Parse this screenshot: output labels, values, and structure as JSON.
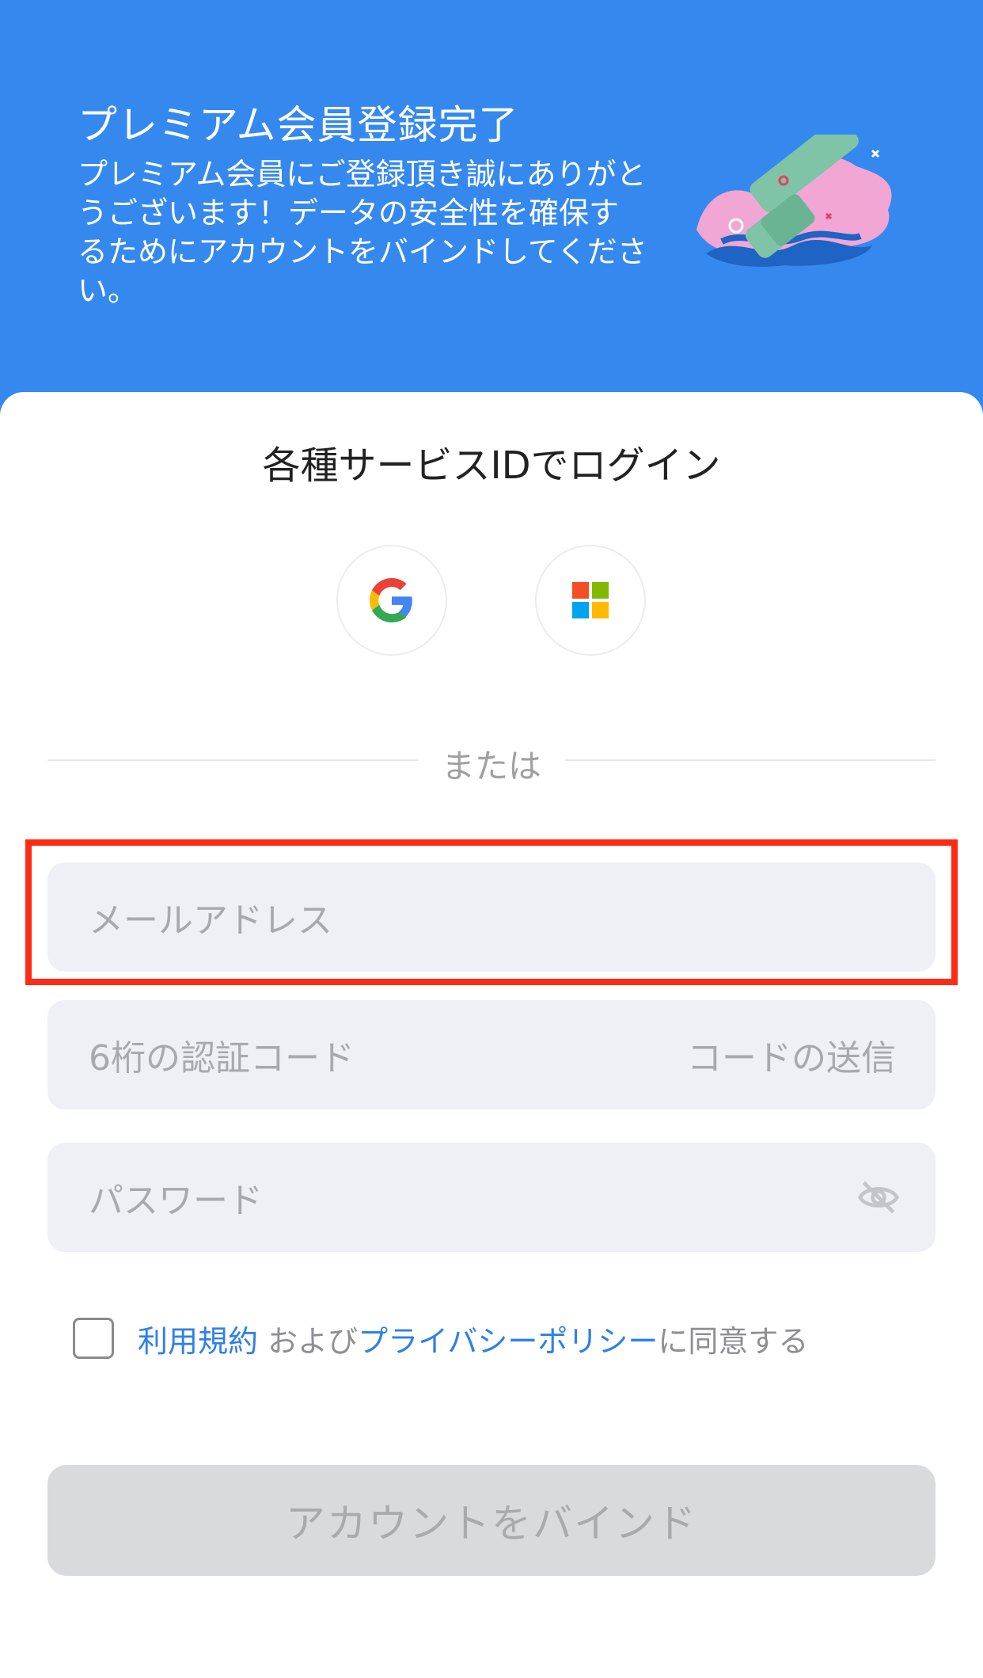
{
  "header": {
    "title": "プレミアム会員登録完了",
    "description": "プレミアム会員にご登録頂き誠にありがとうございます！データの安全性を確保するためにアカウントをバインドしてください。",
    "illustration": "checkmark-illustration"
  },
  "login": {
    "title": "各種サービスIDでログイン",
    "providers": [
      {
        "name": "Google",
        "icon": "google-icon"
      },
      {
        "name": "Microsoft",
        "icon": "microsoft-icon"
      }
    ],
    "divider_text": "または"
  },
  "form": {
    "email_placeholder": "メールアドレス",
    "code_placeholder": "6桁の認証コード",
    "send_code_label": "コードの送信",
    "password_placeholder": "パスワード",
    "password_toggle_icon": "eye-off-icon"
  },
  "agreement": {
    "checked": false,
    "terms_link": "利用規約",
    "and_text": " および",
    "privacy_link": "プライバシーポリシー",
    "suffix_text": "に同意する"
  },
  "bind_button_label": "アカウントをバインド",
  "colors": {
    "header_bg": "#3589ee",
    "link": "#2f80e6",
    "highlight": "#ff2a13",
    "field_bg": "#eef0f5",
    "button_disabled": "#d9dadd"
  }
}
